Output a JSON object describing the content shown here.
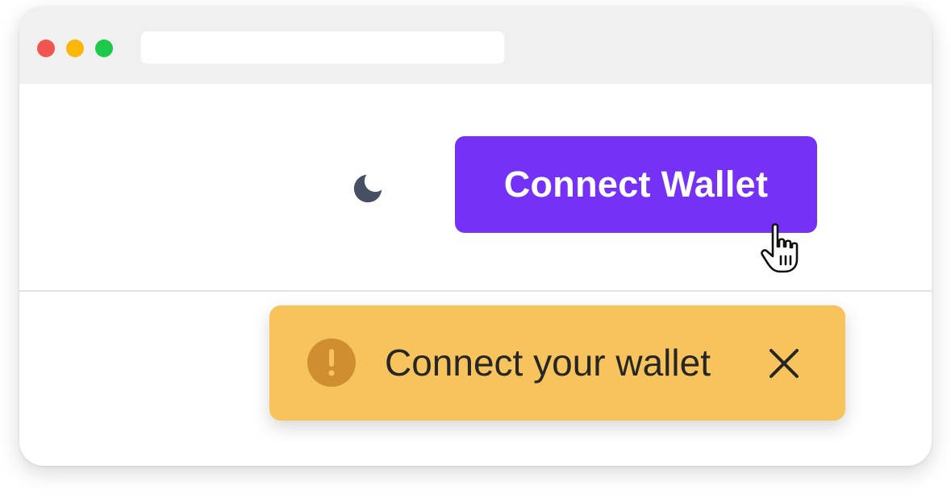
{
  "window": {
    "controls": {
      "close_color": "#f0564f",
      "minimize_color": "#f8b80a",
      "maximize_color": "#1ec94a"
    },
    "address_bar": {
      "value": ""
    }
  },
  "header": {
    "theme_toggle_icon": "moon-icon",
    "connect_button_label": "Connect Wallet",
    "connect_button_color": "#7631f7",
    "cursor_icon": "hand-pointer-icon"
  },
  "toast": {
    "icon": "exclamation-circle-icon",
    "message": "Connect your wallet",
    "close_icon": "close-icon",
    "background_color": "#f6c35c"
  }
}
